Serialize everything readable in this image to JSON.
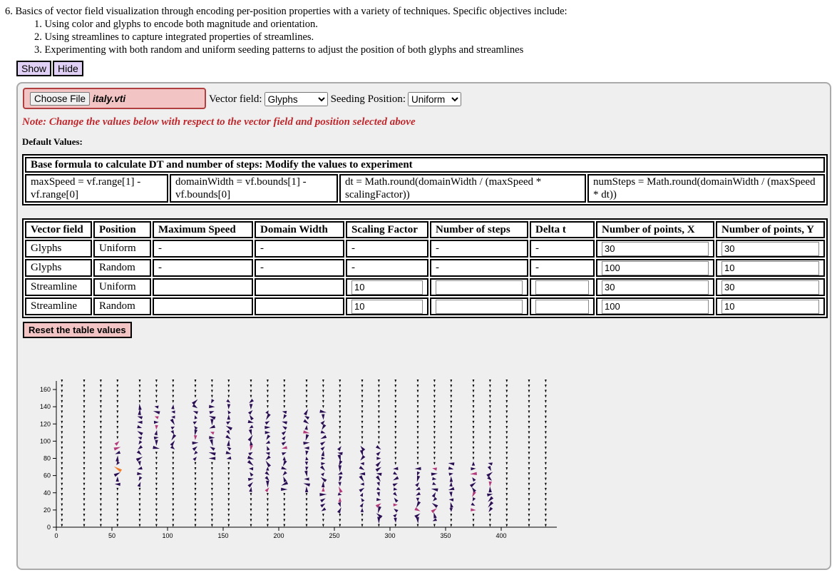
{
  "intro": {
    "heading": "6. Basics of vector field visualization through encoding per-position properties with a variety of techniques. Specific objectives include:",
    "items": [
      "1. Using color and glyphs to encode both magnitude and orientation.",
      "2. Using streamlines to capture integrated properties of streamlines.",
      "3. Experimenting with both random and uniform seeding patterns to adjust the position of both glyphs and streamlines"
    ]
  },
  "buttons": {
    "show": "Show",
    "hide": "Hide"
  },
  "file": {
    "choose_label": "Choose File",
    "file_name": "italy.vti"
  },
  "controls": {
    "vector_field_label": "Vector field:",
    "vector_field_value": "Glyphs",
    "seeding_label": "Seeding Position:",
    "seeding_value": "Uniform"
  },
  "note": "Note: Change the values below with respect to the vector field and position selected above",
  "default_values_label": "Default Values:",
  "formula": {
    "title": "Base formula to calculate DT and number of steps: Modify the values to experiment",
    "cells": [
      "maxSpeed = vf.range[1] - vf.range[0]",
      "domainWidth = vf.bounds[1] - vf.bounds[0]",
      "dt = Math.round(domainWidth / (maxSpeed * scalingFactor))",
      "numSteps = Math.round(domainWidth / (maxSpeed * dt))"
    ]
  },
  "table": {
    "headers": [
      "Vector field",
      "Position",
      "Maximum Speed",
      "Domain Width",
      "Scaling Factor",
      "Number of steps",
      "Delta t",
      "Number of points, X",
      "Number of points, Y"
    ],
    "rows": [
      {
        "field": "Glyphs",
        "position": "Uniform",
        "max_speed": "-",
        "domain_width": "-",
        "scaling": "-",
        "steps": "-",
        "delta": "-",
        "px": "30",
        "py": "30"
      },
      {
        "field": "Glyphs",
        "position": "Random",
        "max_speed": "-",
        "domain_width": "-",
        "scaling": "-",
        "steps": "-",
        "delta": "-",
        "px": "100",
        "py": "10"
      },
      {
        "field": "Streamline",
        "position": "Uniform",
        "scaling_input": "10",
        "steps_input": "",
        "delta_input": "",
        "px": "30",
        "py": "30"
      },
      {
        "field": "Streamline",
        "position": "Random",
        "scaling_input": "10",
        "steps_input": "",
        "delta_input": "",
        "px": "100",
        "py": "10"
      }
    ]
  },
  "reset_label": "Reset the table values",
  "chart_data": {
    "type": "scatter",
    "title": "",
    "xlabel": "",
    "ylabel": "",
    "xlim": [
      0,
      450
    ],
    "ylim": [
      0,
      170
    ],
    "x_ticks": [
      0,
      50,
      100,
      150,
      200,
      250,
      300,
      350,
      400
    ],
    "y_ticks": [
      0,
      20,
      40,
      60,
      80,
      100,
      120,
      140,
      160
    ],
    "grid": false,
    "glyph_columns_x": [
      5,
      25,
      40,
      55,
      75,
      90,
      105,
      125,
      140,
      155,
      175,
      190,
      205,
      225,
      240,
      255,
      275,
      290,
      305,
      325,
      340,
      355,
      375,
      390,
      405,
      425,
      440
    ],
    "glyph_rows_y": [
      2,
      8,
      14,
      20,
      26,
      32,
      38,
      44,
      50,
      56,
      62,
      68,
      74,
      80,
      86,
      92,
      98,
      104,
      110,
      116,
      122,
      128,
      134,
      140,
      146,
      152,
      158,
      164,
      170
    ],
    "colors": {
      "low": "#2a0f52",
      "mid": "#b33a7a",
      "high": "#f57c28",
      "max": "#f3c33b"
    }
  }
}
